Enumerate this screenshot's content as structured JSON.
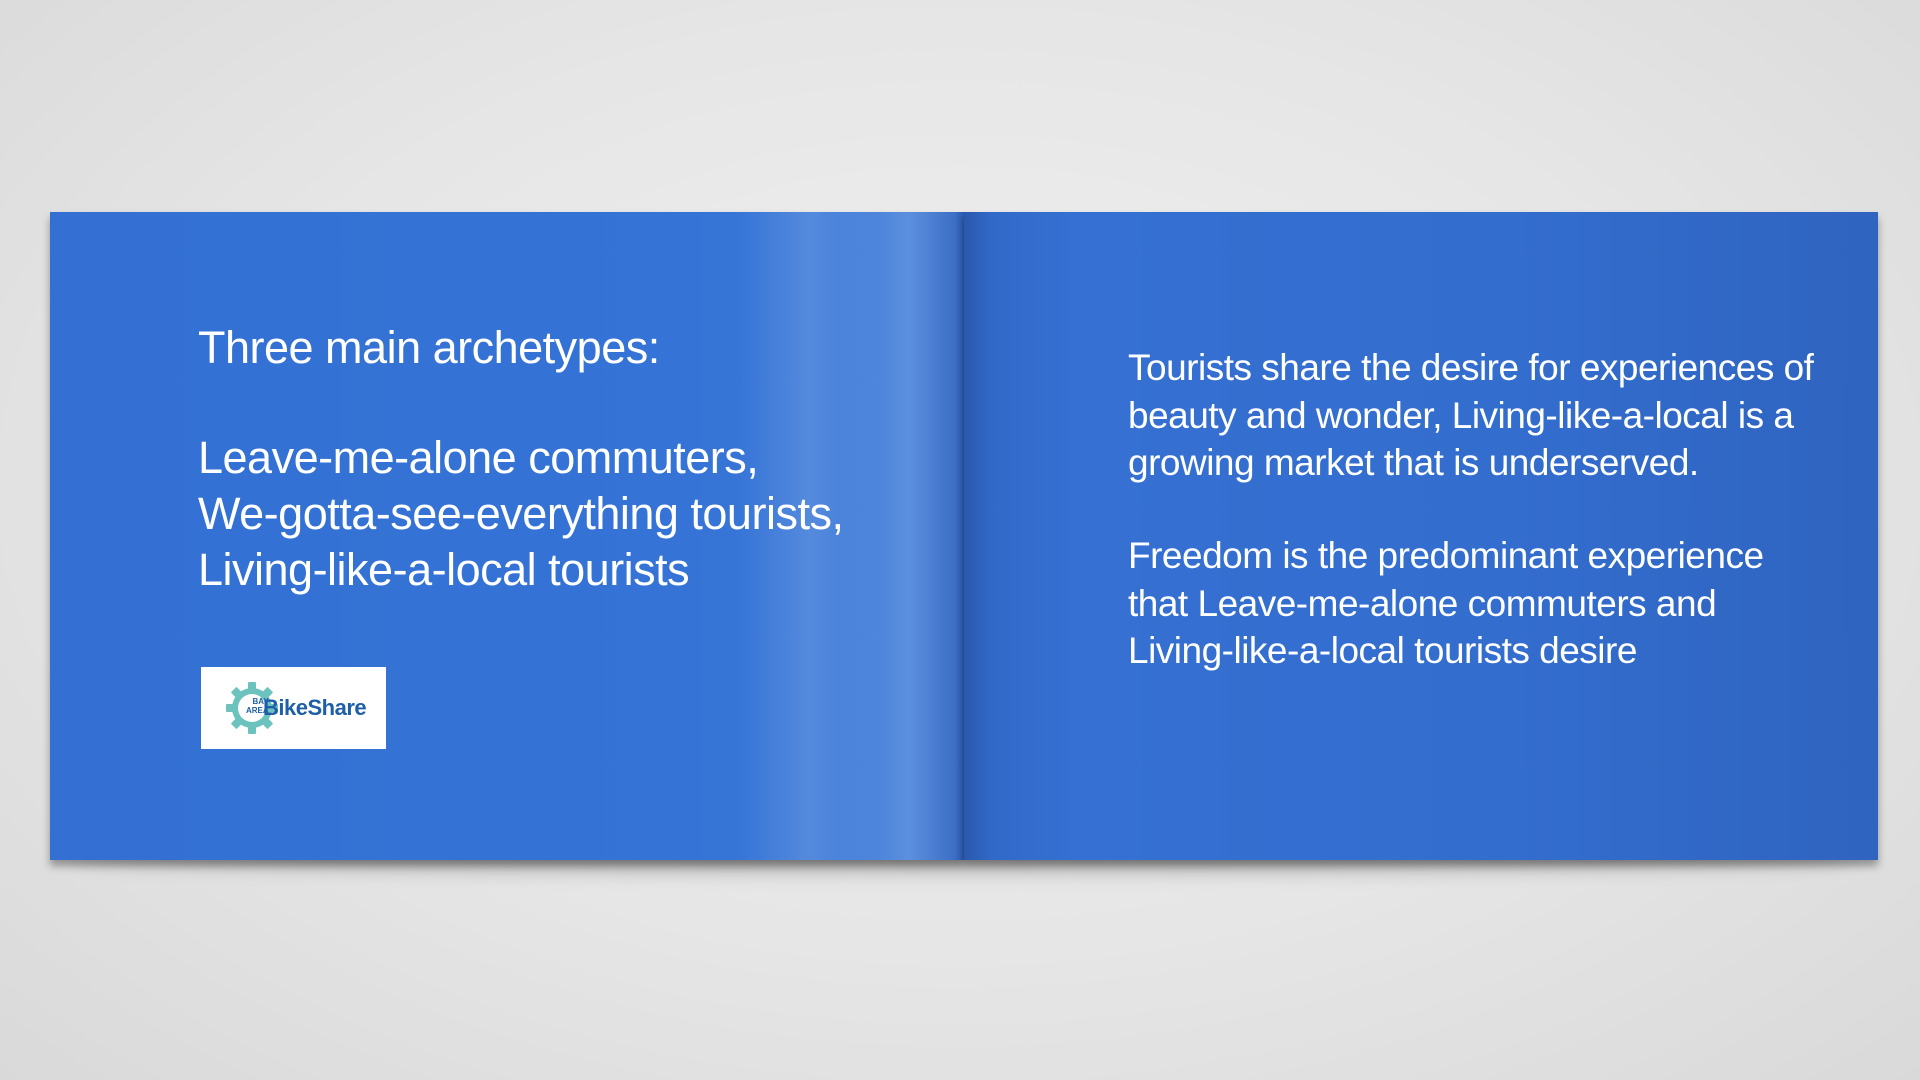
{
  "left_page": {
    "title": "Three main archetypes:",
    "archetypes": [
      "Leave-me-alone commuters,",
      "We-gotta-see-everything tourists,",
      "Living-like-a-local tourists"
    ],
    "logo": {
      "small_text_line1": "BAY",
      "small_text_line2": "AREA",
      "wordmark": "BikeShare",
      "icon": "gear-icon",
      "colors": {
        "gear": "#6cc2bd",
        "text": "#1e5fa8"
      }
    }
  },
  "right_page": {
    "paragraph1": "Tourists share the desire for experiences of beauty and wonder, Living-like-a-local is a growing market that is underserved.",
    "paragraph2": "Freedom is the predominant experience that Leave-me-alone commuters and Living-like-a-local tourists desire"
  },
  "colors": {
    "page_blue": "#346fd0",
    "background": "#e6e6e6",
    "text": "#ffffff"
  }
}
